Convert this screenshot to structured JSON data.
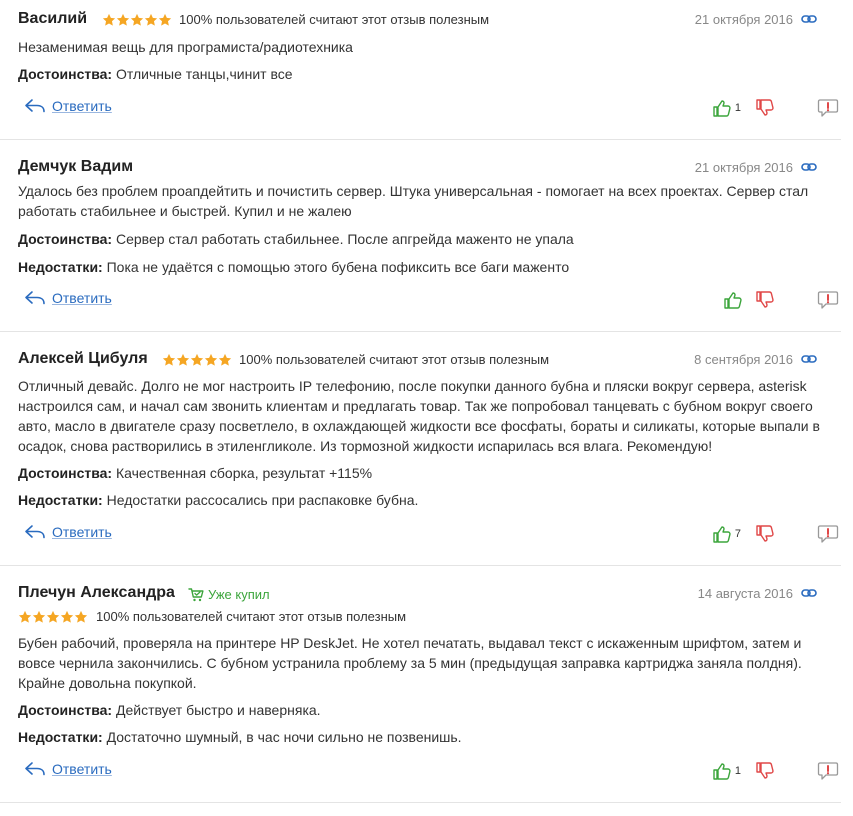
{
  "reviews": [
    {
      "author": "Василий",
      "stars": 5,
      "helpful": "100% пользователей считают этот отзыв полезным",
      "date": "21 октября 2016",
      "text": "Незаменимая вещь для програмиста/радиотехника",
      "pros_label": "Достоинства:",
      "pros": "Отличные танцы,чинит все",
      "reply": "Ответить",
      "likes": "1"
    },
    {
      "author": "Демчук Вадим",
      "date": "21 октября 2016",
      "text": "Удалось без проблем проапдейтить и почистить сервер. Штука универсальная - помогает на всех проектах. Сервер стал работать стабильнее и быстрей. Купил и не жалею",
      "pros_label": "Достоинства:",
      "pros": "Сервер стал работать стабильнее. После апгрейда маженто не упала",
      "cons_label": "Недостатки:",
      "cons": "Пока не удаётся с помощью этого бубена пофиксить все баги маженто",
      "reply": "Ответить"
    },
    {
      "author": "Алексей Цибуля",
      "stars": 5,
      "helpful": "100% пользователей считают этот отзыв полезным",
      "date": "8 сентября 2016",
      "text": "Отличный девайс. Долго не мог настроить IP телефонию, после покупки данного бубна и пляски вокруг сервера, asterisk настроился сам, и начал сам звонить клиентам и предлагать товар. Так же попробовал танцевать с бубном вокруг своего авто, масло в двигателе сразу посветлело, в охлаждающей жидкости все фосфаты, бораты и силикаты, которые выпали в осадок, снова растворились в этиленгликоле. Из тормозной жидкости испарилась вся влага. Рекомендую!",
      "pros_label": "Достоинства:",
      "pros": "Качественная сборка, результат +115%",
      "cons_label": "Недостатки:",
      "cons": "Недостатки рассосались при распаковке бубна.",
      "reply": "Ответить",
      "likes": "7"
    },
    {
      "author": "Плечун Александра",
      "bought": "Уже купил",
      "stars": 5,
      "helpful": "100% пользователей считают этот отзыв полезным",
      "date": "14 августа 2016",
      "text": "Бубен рабочий, проверяла на принтере HP DeskJet. Не хотел печатать, выдавал текст с искаженным шрифтом, затем и вовсе чернила закончились. С бубном устранила проблему за 5 мин (предыдущая заправка картриджа заняла полдня). Крайне довольна покупкой.",
      "pros_label": "Достоинства:",
      "pros": "Действует быстро и наверняка.",
      "cons_label": "Недостатки:",
      "cons": "Достаточно шумный, в час ночи сильно не позвенишь.",
      "reply": "Ответить",
      "likes": "1"
    }
  ],
  "colors": {
    "star": "#f5a623",
    "link": "#2a6bbf",
    "like": "#3ca53c",
    "dislike": "#e04848",
    "muted": "#888888"
  }
}
